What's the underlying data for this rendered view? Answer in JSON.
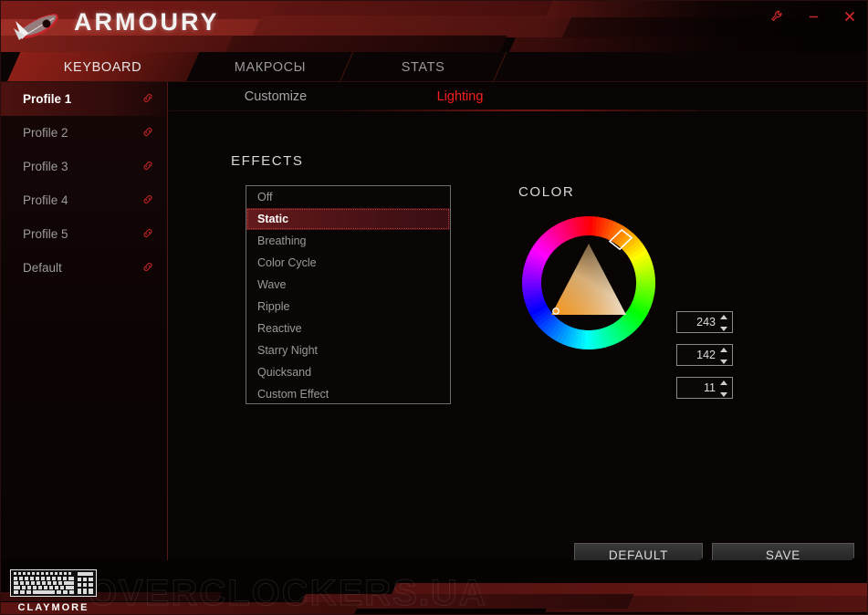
{
  "window": {
    "brand": "ARMOURY",
    "logo_icon": "rog-eye-logo",
    "controls": [
      {
        "name": "settings-wrench-icon",
        "label": "Settings"
      },
      {
        "name": "minimize-icon",
        "label": "Minimize"
      },
      {
        "name": "close-icon",
        "label": "Close"
      }
    ]
  },
  "tabs": [
    {
      "label": "KEYBOARD",
      "active": true
    },
    {
      "label": "МАКРОСЫ",
      "active": false
    },
    {
      "label": "STATS",
      "active": false
    }
  ],
  "sidebar": {
    "items": [
      {
        "label": "Profile 1",
        "active": true,
        "link_icon": "link-icon"
      },
      {
        "label": "Profile 2",
        "active": false,
        "link_icon": "link-icon"
      },
      {
        "label": "Profile 3",
        "active": false,
        "link_icon": "link-icon"
      },
      {
        "label": "Profile 4",
        "active": false,
        "link_icon": "link-icon"
      },
      {
        "label": "Profile 5",
        "active": false,
        "link_icon": "link-icon"
      },
      {
        "label": "Default",
        "active": false,
        "link_icon": "link-icon"
      }
    ]
  },
  "subtabs": [
    {
      "label": "Customize",
      "active": false
    },
    {
      "label": "Lighting",
      "active": true
    }
  ],
  "effects": {
    "heading": "EFFECTS",
    "items": [
      {
        "label": "Off",
        "selected": false
      },
      {
        "label": "Static",
        "selected": true
      },
      {
        "label": "Breathing",
        "selected": false
      },
      {
        "label": "Color Cycle",
        "selected": false
      },
      {
        "label": "Wave",
        "selected": false
      },
      {
        "label": "Ripple",
        "selected": false
      },
      {
        "label": "Reactive",
        "selected": false
      },
      {
        "label": "Starry Night",
        "selected": false
      },
      {
        "label": "Quicksand",
        "selected": false
      },
      {
        "label": "Custom Effect",
        "selected": false
      }
    ]
  },
  "color": {
    "heading": "COLOR",
    "wheel_icon": "color-wheel",
    "triangle_icon": "saturation-value-triangle",
    "hue_marker_icon": "hue-ring-marker",
    "sv_marker_icon": "triangle-marker",
    "selected_hex": "#f38e0b",
    "channels": [
      {
        "name": "red-value",
        "value": "243"
      },
      {
        "name": "green-value",
        "value": "142"
      },
      {
        "name": "blue-value",
        "value": "11"
      }
    ]
  },
  "footer_buttons": {
    "default_label": "DEFAULT",
    "save_label": "SAVE"
  },
  "footer": {
    "watermark": "OVERCLOCKERS.UA",
    "device_name": "CLAYMORE",
    "device_icon": "keyboard-icon"
  },
  "theme": {
    "accent": "#f42020",
    "accent_dark": "#8e2018",
    "background": "#090404",
    "text": "#9a9a9a",
    "text_active": "#ffffff"
  }
}
